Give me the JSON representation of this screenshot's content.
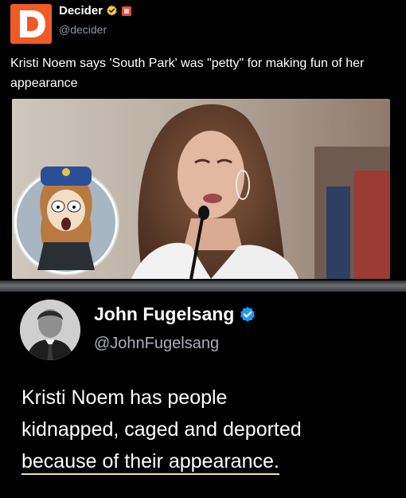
{
  "top_tweet": {
    "author_name": "Decider",
    "handle": "@decider",
    "text": "Kristi Noem says 'South Park' was \"petty\" for making fun of her appearance",
    "brand_color": "#f05a24",
    "icons": [
      "decider-logo-icon",
      "verified-badge-icon",
      "org-badge-icon"
    ]
  },
  "bottom_tweet": {
    "author_name": "John Fugelsang",
    "handle": "@JohnFugelsang",
    "text_line_1": "Kristi Noem has people",
    "text_line_2": "kidnapped, caged and deported",
    "text_line_3": "because of their appearance.",
    "highlight_color": "#f0e3a4",
    "icons": [
      "verified-badge-icon"
    ]
  },
  "colors": {
    "background": "#000000",
    "verified_blue": "#1d9bf0",
    "handle_gray": "#8b98a5"
  }
}
